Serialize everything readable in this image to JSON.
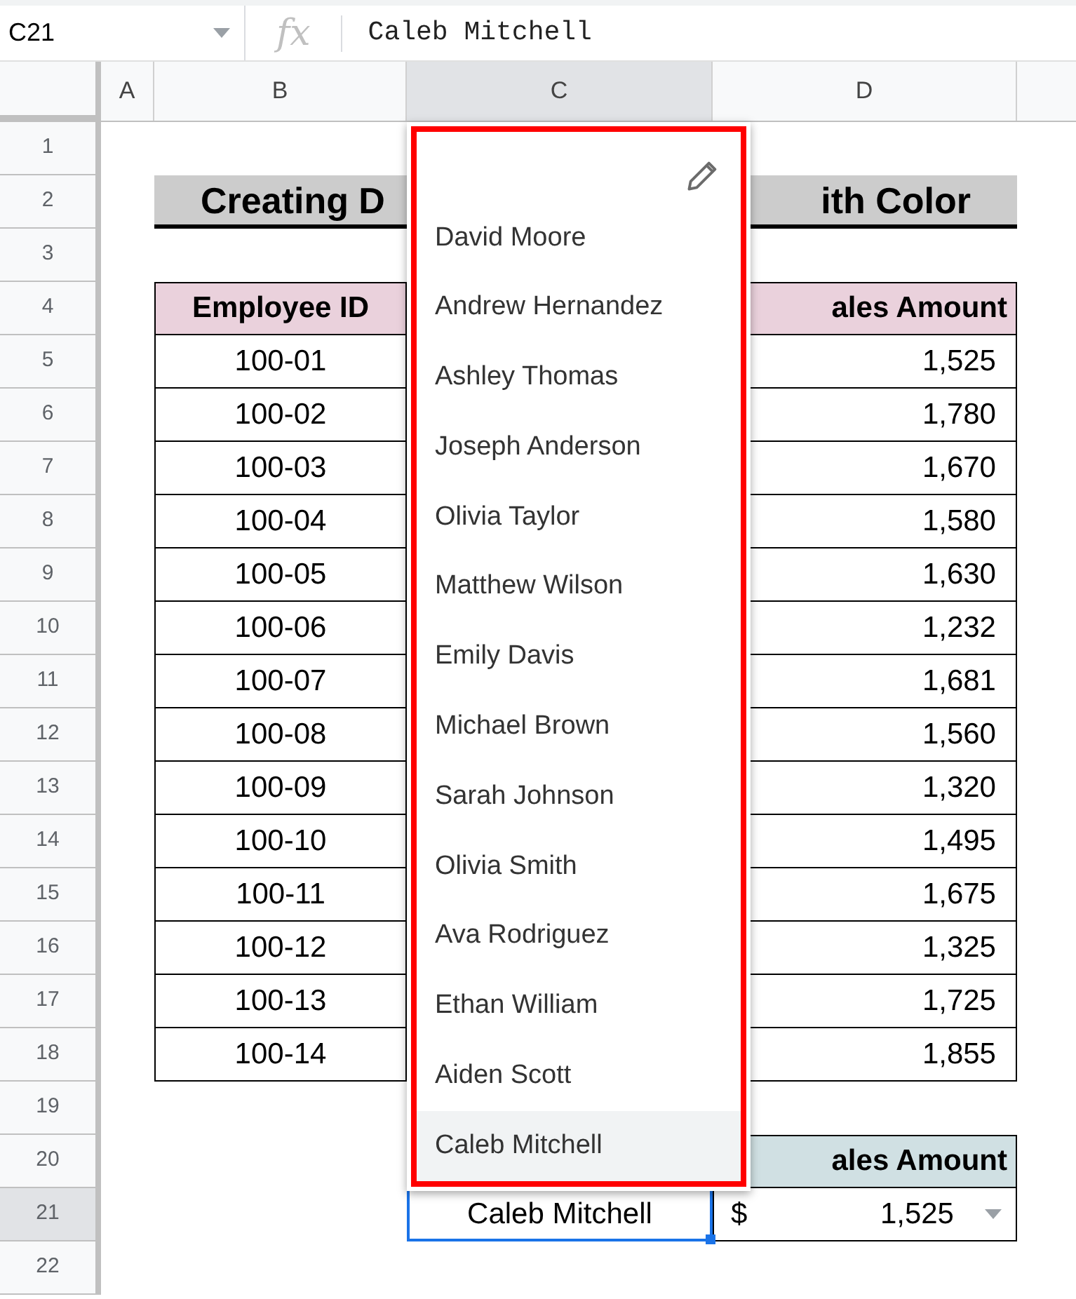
{
  "formula_bar": {
    "cell_ref": "C21",
    "fx": "fx",
    "value": "Caleb Mitchell"
  },
  "columns": [
    {
      "label": "A",
      "selected": false
    },
    {
      "label": "B",
      "selected": false
    },
    {
      "label": "C",
      "selected": true
    },
    {
      "label": "D",
      "selected": false
    }
  ],
  "row_numbers": [
    {
      "label": "1",
      "selected": false
    },
    {
      "label": "2",
      "selected": false
    },
    {
      "label": "3",
      "selected": false
    },
    {
      "label": "4",
      "selected": false
    },
    {
      "label": "5",
      "selected": false
    },
    {
      "label": "6",
      "selected": false
    },
    {
      "label": "7",
      "selected": false
    },
    {
      "label": "8",
      "selected": false
    },
    {
      "label": "9",
      "selected": false
    },
    {
      "label": "10",
      "selected": false
    },
    {
      "label": "11",
      "selected": false
    },
    {
      "label": "12",
      "selected": false
    },
    {
      "label": "13",
      "selected": false
    },
    {
      "label": "14",
      "selected": false
    },
    {
      "label": "15",
      "selected": false
    },
    {
      "label": "16",
      "selected": false
    },
    {
      "label": "17",
      "selected": false
    },
    {
      "label": "18",
      "selected": false
    },
    {
      "label": "19",
      "selected": false
    },
    {
      "label": "20",
      "selected": false
    },
    {
      "label": "21",
      "selected": true
    },
    {
      "label": "22",
      "selected": false
    }
  ],
  "title": {
    "left": "Creating D",
    "right": "ith Color"
  },
  "table": {
    "columns": [
      "Employee ID",
      "ales Amount"
    ],
    "rows": [
      {
        "id": "100-01",
        "amount": "1,525"
      },
      {
        "id": "100-02",
        "amount": "1,780"
      },
      {
        "id": "100-03",
        "amount": "1,670"
      },
      {
        "id": "100-04",
        "amount": "1,580"
      },
      {
        "id": "100-05",
        "amount": "1,630"
      },
      {
        "id": "100-06",
        "amount": "1,232"
      },
      {
        "id": "100-07",
        "amount": "1,681"
      },
      {
        "id": "100-08",
        "amount": "1,560"
      },
      {
        "id": "100-09",
        "amount": "1,320"
      },
      {
        "id": "100-10",
        "amount": "1,495"
      },
      {
        "id": "100-11",
        "amount": "1,675"
      },
      {
        "id": "100-12",
        "amount": "1,325"
      },
      {
        "id": "100-13",
        "amount": "1,725"
      },
      {
        "id": "100-14",
        "amount": "1,855"
      }
    ]
  },
  "lookup": {
    "header": "ales Amount",
    "name": "Caleb Mitchell",
    "currency": "$",
    "amount": "1,525"
  },
  "dropdown": {
    "items": [
      {
        "label": "David Moore",
        "selected": false
      },
      {
        "label": "Andrew Hernandez",
        "selected": false
      },
      {
        "label": "Ashley Thomas",
        "selected": false
      },
      {
        "label": "Joseph Anderson",
        "selected": false
      },
      {
        "label": "Olivia Taylor",
        "selected": false
      },
      {
        "label": "Matthew Wilson",
        "selected": false
      },
      {
        "label": "Emily Davis",
        "selected": false
      },
      {
        "label": "Michael Brown",
        "selected": false
      },
      {
        "label": "Sarah Johnson",
        "selected": false
      },
      {
        "label": "Olivia Smith",
        "selected": false
      },
      {
        "label": "Ava Rodriguez",
        "selected": false
      },
      {
        "label": "Ethan William",
        "selected": false
      },
      {
        "label": "Aiden Scott",
        "selected": false
      },
      {
        "label": "Caleb Mitchell",
        "selected": true
      }
    ]
  }
}
